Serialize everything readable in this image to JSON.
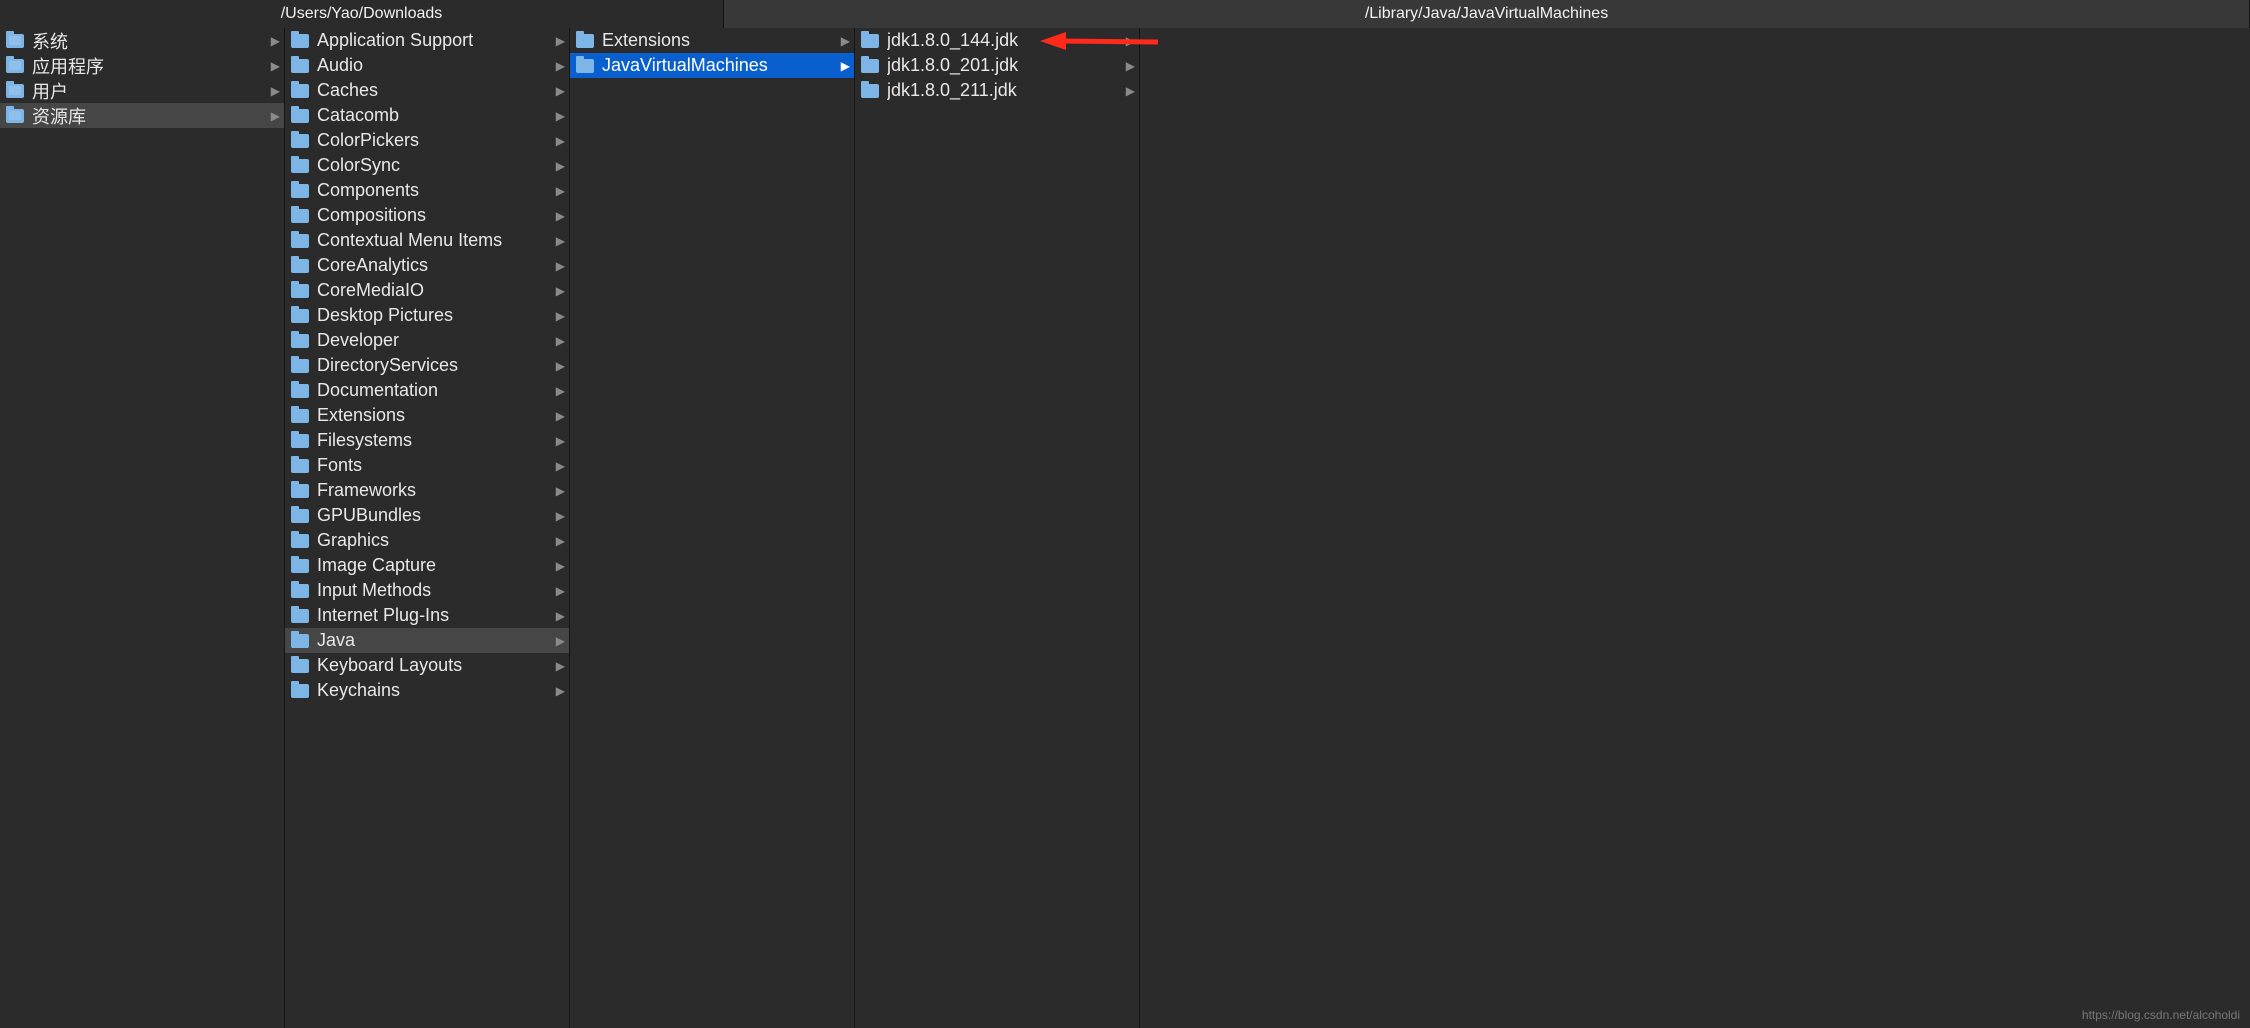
{
  "tabs": {
    "left": "/Users/Yao/Downloads",
    "right": "/Library/Java/JavaVirtualMachines"
  },
  "columns": {
    "c1": [
      {
        "label": "系统",
        "style": "sys",
        "arrow": true
      },
      {
        "label": "应用程序",
        "style": "sys",
        "arrow": true
      },
      {
        "label": "用户",
        "style": "sys",
        "arrow": true
      },
      {
        "label": "资源库",
        "style": "sys",
        "arrow": true,
        "selected": "gray"
      }
    ],
    "c2": [
      {
        "label": "Application Support",
        "arrow": true
      },
      {
        "label": "Audio",
        "arrow": true
      },
      {
        "label": "Caches",
        "arrow": true
      },
      {
        "label": "Catacomb",
        "arrow": true
      },
      {
        "label": "ColorPickers",
        "arrow": true
      },
      {
        "label": "ColorSync",
        "arrow": true
      },
      {
        "label": "Components",
        "arrow": true
      },
      {
        "label": "Compositions",
        "arrow": true
      },
      {
        "label": "Contextual Menu Items",
        "arrow": true
      },
      {
        "label": "CoreAnalytics",
        "arrow": true
      },
      {
        "label": "CoreMediaIO",
        "arrow": true
      },
      {
        "label": "Desktop Pictures",
        "arrow": true
      },
      {
        "label": "Developer",
        "arrow": true
      },
      {
        "label": "DirectoryServices",
        "arrow": true
      },
      {
        "label": "Documentation",
        "arrow": true
      },
      {
        "label": "Extensions",
        "arrow": true
      },
      {
        "label": "Filesystems",
        "arrow": true
      },
      {
        "label": "Fonts",
        "arrow": true
      },
      {
        "label": "Frameworks",
        "arrow": true
      },
      {
        "label": "GPUBundles",
        "arrow": true
      },
      {
        "label": "Graphics",
        "arrow": true
      },
      {
        "label": "Image Capture",
        "arrow": true
      },
      {
        "label": "Input Methods",
        "arrow": true
      },
      {
        "label": "Internet Plug-Ins",
        "arrow": true
      },
      {
        "label": "Java",
        "arrow": true,
        "selected": "gray"
      },
      {
        "label": "Keyboard Layouts",
        "arrow": true
      },
      {
        "label": "Keychains",
        "arrow": true
      }
    ],
    "c3": [
      {
        "label": "Extensions",
        "arrow": true
      },
      {
        "label": "JavaVirtualMachines",
        "arrow": true,
        "selected": "blue"
      }
    ],
    "c4": [
      {
        "label": "jdk1.8.0_144.jdk",
        "arrow": true
      },
      {
        "label": "jdk1.8.0_201.jdk",
        "arrow": true
      },
      {
        "label": "jdk1.8.0_211.jdk",
        "arrow": true
      }
    ]
  },
  "annotation": {
    "target_index": 0,
    "color": "#ff2a1a"
  },
  "watermark": "https://blog.csdn.net/alcoholdi"
}
